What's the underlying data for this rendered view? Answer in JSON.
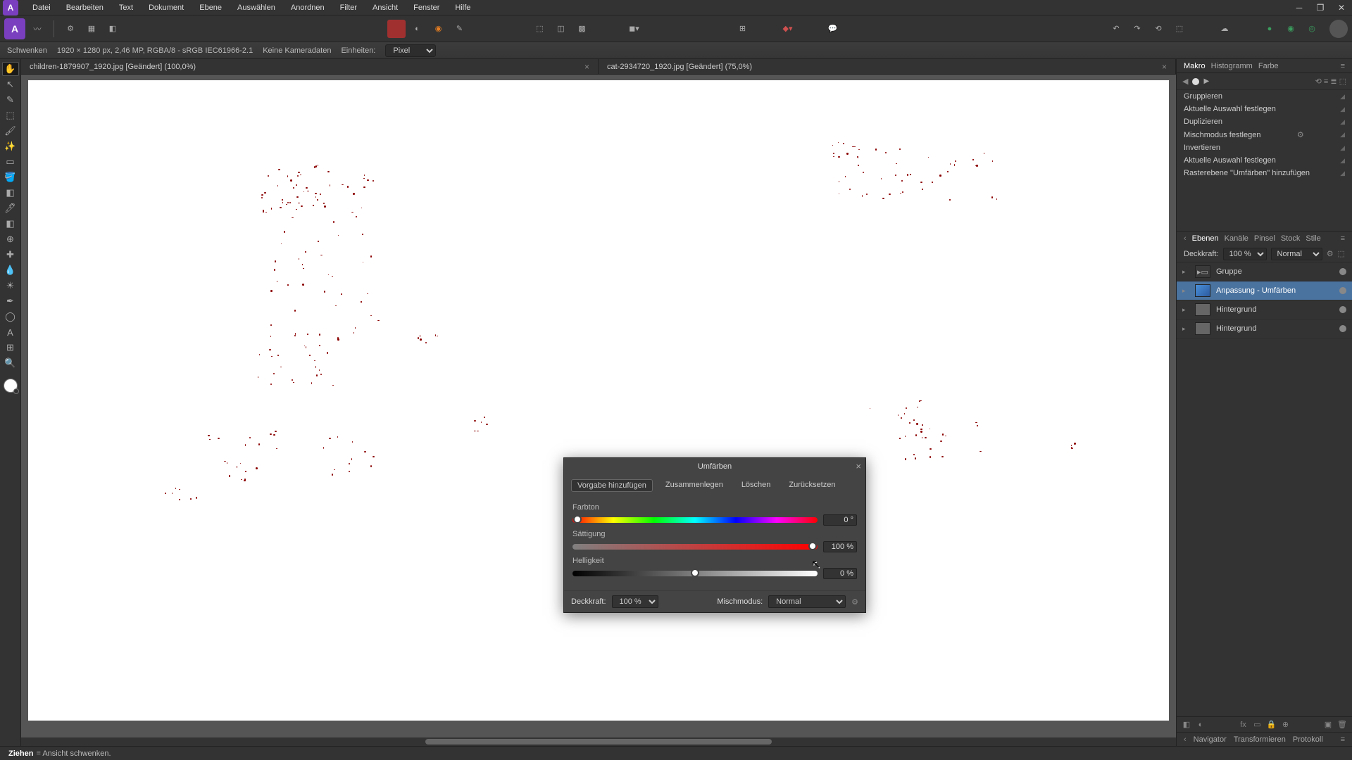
{
  "menu": [
    "Datei",
    "Bearbeiten",
    "Text",
    "Dokument",
    "Ebene",
    "Auswählen",
    "Anordnen",
    "Filter",
    "Ansicht",
    "Fenster",
    "Hilfe"
  ],
  "context": {
    "tool": "Schwenken",
    "dims": "1920 × 1280 px, 2,46 MP, RGBA/8 - sRGB IEC61966-2.1",
    "camera": "Keine Kameradaten",
    "units_label": "Einheiten:",
    "units_value": "Pixel"
  },
  "tabs": [
    {
      "title": "children-1879907_1920.jpg [Geändert] (100,0%)"
    },
    {
      "title": "cat-2934720_1920.jpg [Geändert] (75,0%)"
    }
  ],
  "macro": {
    "tabs": [
      "Makro",
      "Histogramm",
      "Farbe"
    ],
    "items": [
      {
        "label": "Gruppieren",
        "gear": false
      },
      {
        "label": "Aktuelle Auswahl festlegen",
        "gear": false
      },
      {
        "label": "Duplizieren",
        "gear": false
      },
      {
        "label": "Mischmodus festlegen",
        "gear": true
      },
      {
        "label": "Invertieren",
        "gear": false
      },
      {
        "label": "Aktuelle Auswahl festlegen",
        "gear": false
      },
      {
        "label": "Rasterebene \"Umfärben\" hinzufügen",
        "gear": false
      }
    ]
  },
  "layers": {
    "tabs": [
      "Ebenen",
      "Kanäle",
      "Pinsel",
      "Stock",
      "Stile"
    ],
    "opacity_label": "Deckkraft:",
    "opacity_value": "100 %",
    "blend": "Normal",
    "items": [
      {
        "name": "Gruppe",
        "type": "group",
        "selected": false
      },
      {
        "name": "Anpassung - Umfärben",
        "type": "adj",
        "selected": true
      },
      {
        "name": "Hintergrund",
        "type": "pixel",
        "selected": false
      },
      {
        "name": "Hintergrund",
        "type": "pixel",
        "selected": false
      }
    ]
  },
  "nav_tabs": [
    "Navigator",
    "Transformieren",
    "Protokoll"
  ],
  "status": {
    "action": "Ziehen",
    "hint": "= Ansicht schwenken."
  },
  "dialog": {
    "title": "Umfärben",
    "buttons": [
      "Vorgabe hinzufügen",
      "Zusammenlegen",
      "Löschen",
      "Zurücksetzen"
    ],
    "hue_label": "Farbton",
    "hue_value": "0 °",
    "sat_label": "Sättigung",
    "sat_value": "100 %",
    "lit_label": "Helligkeit",
    "lit_value": "0 %",
    "opacity_label": "Deckkraft:",
    "opacity_value": "100 %",
    "blend_label": "Mischmodus:",
    "blend_value": "Normal"
  }
}
